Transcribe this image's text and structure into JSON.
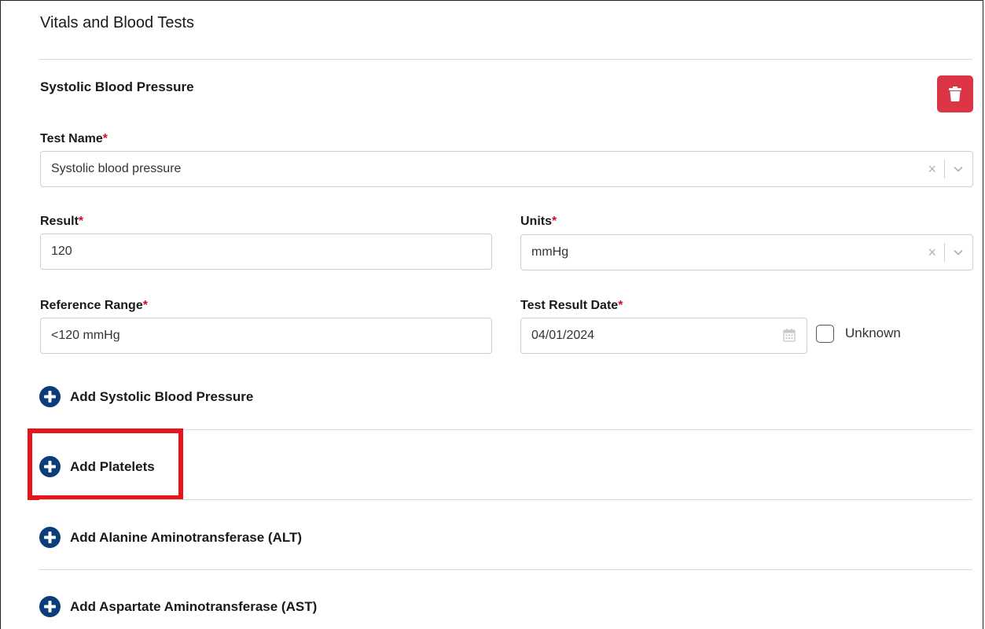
{
  "section": {
    "title": "Vitals and Blood Tests"
  },
  "test_block": {
    "title": "Systolic Blood Pressure",
    "delete_icon": "trash-icon",
    "test_name": {
      "label": "Test Name",
      "required_mark": "*",
      "value": "Systolic blood pressure"
    },
    "result": {
      "label": "Result",
      "required_mark": "*",
      "value": "120"
    },
    "units": {
      "label": "Units",
      "required_mark": "*",
      "value": "mmHg"
    },
    "reference_range": {
      "label": "Reference Range",
      "required_mark": "*",
      "value": "<120 mmHg"
    },
    "test_result_date": {
      "label": "Test Result Date",
      "required_mark": "*",
      "value": "04/01/2024",
      "icon": "calendar-icon"
    },
    "unknown_checkbox": {
      "label": "Unknown",
      "checked": false
    }
  },
  "add_buttons": {
    "systolic": "Add Systolic Blood Pressure",
    "platelets": "Add Platelets",
    "alt": "Add Alanine Aminotransferase (ALT)",
    "ast": "Add Aspartate Aminotransferase (AST)"
  },
  "icons": {
    "clear": "×",
    "add": "plus-circle-icon",
    "dropdown": "chevron-down-icon"
  },
  "colors": {
    "delete": "#dc3545",
    "add_icon": "#0b3d7a",
    "required": "#c8102e",
    "highlight": "#e8141b"
  }
}
